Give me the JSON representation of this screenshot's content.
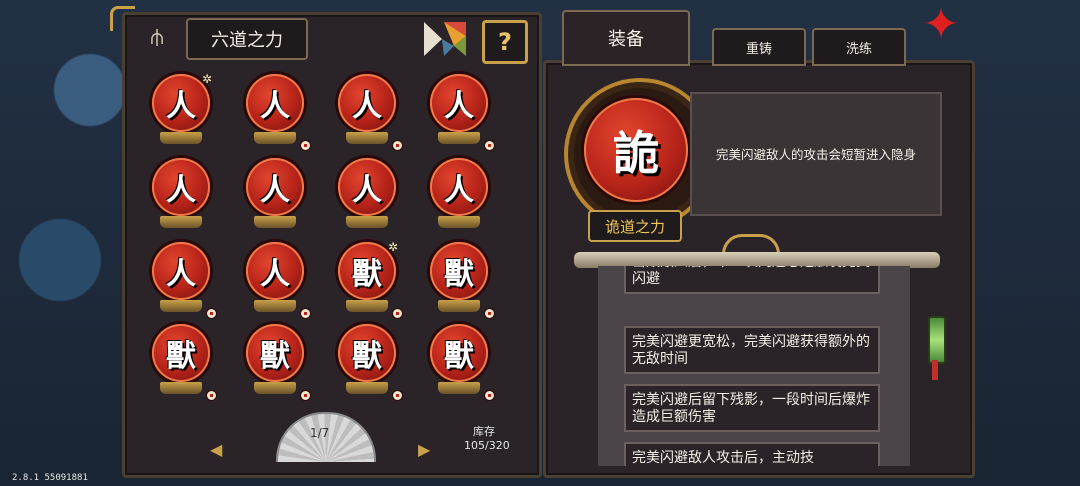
{
  "left": {
    "title": "六道之力",
    "help_label": "?",
    "tokens": [
      {
        "glyph": "人",
        "star": "✲",
        "lvl": false
      },
      {
        "glyph": "人",
        "star": "",
        "lvl": true
      },
      {
        "glyph": "人",
        "star": "",
        "lvl": true
      },
      {
        "glyph": "人",
        "star": "",
        "lvl": true
      },
      {
        "glyph": "人",
        "star": "",
        "lvl": false
      },
      {
        "glyph": "人",
        "star": "",
        "lvl": false
      },
      {
        "glyph": "人",
        "star": "",
        "lvl": false
      },
      {
        "glyph": "人",
        "star": "",
        "lvl": false
      },
      {
        "glyph": "人",
        "star": "",
        "lvl": true
      },
      {
        "glyph": "人",
        "star": "",
        "lvl": true
      },
      {
        "glyph": "獸",
        "star": "✲",
        "lvl": true
      },
      {
        "glyph": "獸",
        "star": "",
        "lvl": true
      },
      {
        "glyph": "獸",
        "star": "",
        "lvl": true
      },
      {
        "glyph": "獸",
        "star": "",
        "lvl": true
      },
      {
        "glyph": "獸",
        "star": "",
        "lvl": true
      },
      {
        "glyph": "獸",
        "star": "",
        "lvl": true
      }
    ],
    "page": "1/7",
    "stock_label": "库存",
    "stock_value": "105/320"
  },
  "right": {
    "tabs": {
      "equip": "装备",
      "recast": "重铸",
      "refine": "洗练"
    },
    "selected": {
      "glyph": "詭",
      "name": "诡道之力",
      "description": "完美闪避敌人的攻击会短暂进入隐身"
    },
    "effects": [
      "击败敌人后，下一次闪避必定触发完美闪避",
      "完美闪避更宽松，完美闪避获得额外的无敌时间",
      "完美闪避后留下残影，一段时间后爆炸造成巨额伤害",
      "完美闪避敌人攻击后，主动技"
    ]
  },
  "version": "2.8.1 55091881"
}
